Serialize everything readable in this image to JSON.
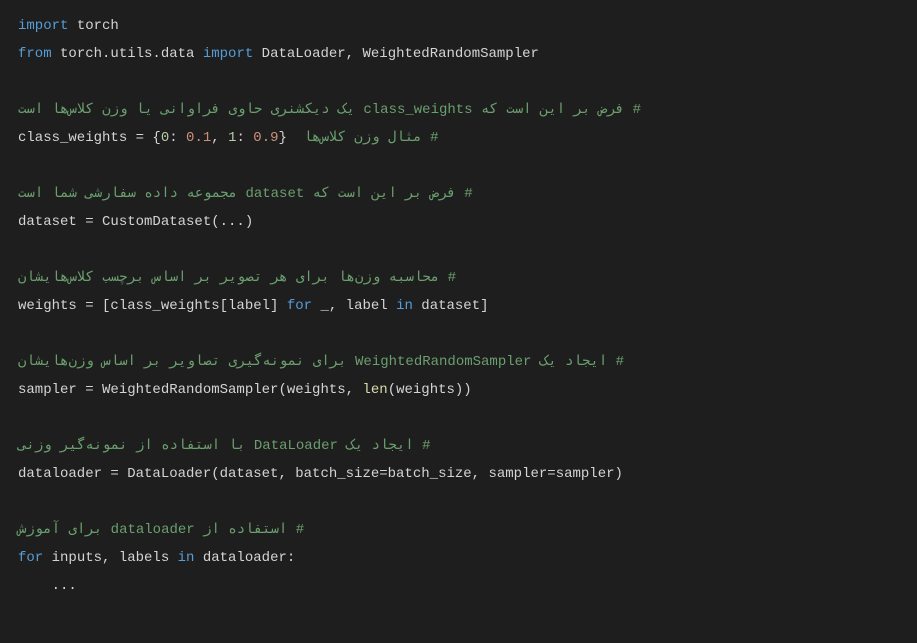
{
  "code": {
    "lines": [
      {
        "segments": [
          {
            "text": "import",
            "class": "keyword"
          },
          {
            "text": " torch",
            "class": "white-text"
          }
        ]
      },
      {
        "segments": [
          {
            "text": "from",
            "class": "keyword"
          },
          {
            "text": " torch.utils.data ",
            "class": "white-text"
          },
          {
            "text": "import",
            "class": "keyword"
          },
          {
            "text": " DataLoader, WeightedRandomSampler",
            "class": "white-text"
          }
        ]
      },
      {
        "segments": [
          {
            "text": "",
            "class": "white-text"
          }
        ]
      },
      {
        "segments": [
          {
            "text": "یک دیکشنری حاوی فراوانی یا وزن کلاس‌ها است class_weights فرض بر این است که #",
            "class": "comment"
          }
        ]
      },
      {
        "segments": [
          {
            "text": "class_weights = {",
            "class": "white-text"
          },
          {
            "text": "0",
            "class": "string-key"
          },
          {
            "text": ": ",
            "class": "white-text"
          },
          {
            "text": "0.1",
            "class": "number"
          },
          {
            "text": ", ",
            "class": "white-text"
          },
          {
            "text": "1",
            "class": "string-key"
          },
          {
            "text": ": ",
            "class": "white-text"
          },
          {
            "text": "0.9",
            "class": "number"
          },
          {
            "text": "}  ",
            "class": "white-text"
          },
          {
            "text": "مثال وزن کلاس‌ها #",
            "class": "comment"
          }
        ]
      },
      {
        "segments": [
          {
            "text": "",
            "class": "white-text"
          }
        ]
      },
      {
        "segments": [
          {
            "text": "مجموعه داده سفارشی شما است dataset فرض بر این است که #",
            "class": "comment"
          }
        ]
      },
      {
        "segments": [
          {
            "text": "dataset = CustomDataset(...)",
            "class": "white-text"
          }
        ]
      },
      {
        "segments": [
          {
            "text": "",
            "class": "white-text"
          }
        ]
      },
      {
        "segments": [
          {
            "text": "محاسبه وزن‌ها برای هر تصویر بر اساس برچسب کلاس‌هایشان #",
            "class": "comment"
          }
        ]
      },
      {
        "segments": [
          {
            "text": "weights = [class_weights[label] ",
            "class": "white-text"
          },
          {
            "text": "for",
            "class": "keyword"
          },
          {
            "text": " _, label ",
            "class": "white-text"
          },
          {
            "text": "in",
            "class": "keyword"
          },
          {
            "text": " dataset]",
            "class": "white-text"
          }
        ]
      },
      {
        "segments": [
          {
            "text": "",
            "class": "white-text"
          }
        ]
      },
      {
        "segments": [
          {
            "text": "برای نمونه‌گیری تصاویر بر اساس وزن‌هایشان WeightedRandomSampler ایجاد یک #",
            "class": "comment"
          }
        ]
      },
      {
        "segments": [
          {
            "text": "sampler = WeightedRandomSampler(weights, ",
            "class": "white-text"
          },
          {
            "text": "len",
            "class": "function-call"
          },
          {
            "text": "(weights))",
            "class": "white-text"
          }
        ]
      },
      {
        "segments": [
          {
            "text": "",
            "class": "white-text"
          }
        ]
      },
      {
        "segments": [
          {
            "text": "با استفاده از نمونه‌گیر وزنی DataLoader ایجاد یک #",
            "class": "comment"
          }
        ]
      },
      {
        "segments": [
          {
            "text": "dataloader = DataLoader(dataset, batch_size=batch_size, sampler=sampler)",
            "class": "white-text"
          }
        ]
      },
      {
        "segments": [
          {
            "text": "",
            "class": "white-text"
          }
        ]
      },
      {
        "segments": [
          {
            "text": "برای آموزش dataloader استفاده از #",
            "class": "comment"
          }
        ]
      },
      {
        "segments": [
          {
            "text": "for",
            "class": "keyword"
          },
          {
            "text": " inputs, labels ",
            "class": "white-text"
          },
          {
            "text": "in",
            "class": "keyword"
          },
          {
            "text": " dataloader:",
            "class": "white-text"
          }
        ]
      },
      {
        "segments": [
          {
            "text": "    ...",
            "class": "white-text"
          }
        ]
      }
    ]
  }
}
